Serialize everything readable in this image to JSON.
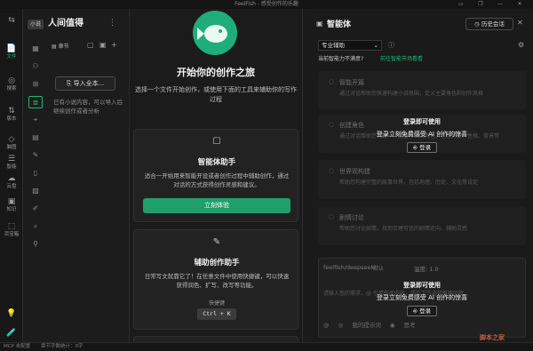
{
  "window": {
    "title": "FeelFish - 感受创作的乐趣",
    "controls": [
      "▭",
      "❐",
      "—",
      "✕"
    ]
  },
  "rail": {
    "items": [
      {
        "icon": "📄",
        "label": "文件",
        "active": true
      },
      {
        "icon": "◎",
        "label": "搜索"
      },
      {
        "icon": "⇅",
        "label": "版本"
      },
      {
        "icon": "◇",
        "label": "脑图"
      },
      {
        "icon": "☰",
        "label": "智能"
      },
      {
        "icon": "☁",
        "label": "云盘"
      },
      {
        "icon": "▣",
        "label": "知识"
      },
      {
        "icon": "⬚",
        "label": "百宝箱"
      }
    ],
    "bottom": [
      "💡",
      "🧪"
    ]
  },
  "files": {
    "type_badge": "小说",
    "book_title": "人间值得",
    "chapter_header": "章节",
    "import_button": "导入全本...",
    "import_hint": "已有小说内容，可以导入后继续创作或者分析"
  },
  "main": {
    "headline": "开始你的创作之旅",
    "subline": "选择一个文件开始创作，或使用下面的工具来辅助你的写作过程",
    "card1": {
      "icon": "☐",
      "title": "智能体助手",
      "desc": "适合一开始用来智能开设或者创作过程中辅助创作，通过对话的方式获得创作灵感和建议。",
      "button": "立刻体验"
    },
    "card2": {
      "icon": "✎",
      "title": "辅助创作助手",
      "desc": "日常写文就靠它了！在任意文件中使用快捷键，可以快速获得润色、扩写、改写等功能。",
      "shortcut_label": "快捷键",
      "shortcut": "Ctrl + K"
    }
  },
  "agent": {
    "title": "智能体",
    "history_button": "历史会话",
    "mode": "专业辅助",
    "mode_note": "当前智能力不满意?",
    "mode_link": "前往智能市场看看",
    "items": [
      {
        "title": "智能开篇",
        "desc": "通过对话帮助您快速构建小说氛围，定义主要角色和创作风格"
      },
      {
        "title": "创建角色",
        "desc": "通过对话帮助您构建一个完整丰满的角色，包括外貌、性格、背景等"
      },
      {
        "title": "世界观构建",
        "desc": "帮助您构建完整的故事世界，包括地理、历史、文化等设定"
      },
      {
        "title": "剧情讨论",
        "desc": "帮助您讨论剧情，找到合理可信的剧情走向，辅助灵感"
      }
    ],
    "login_title": "登录即可使用",
    "login_desc": "登录立刻免费感受 AI 创作的惊喜",
    "login_button": "登录",
    "model": "feelfish/deepseek",
    "model_tag": "默认",
    "temperature": "温度: 1.0",
    "placeholder": "请输入您的需求，@ 引用作品内容，或在下方选择推荐问题...",
    "tools": [
      "@",
      "◎",
      "我的提示词",
      "◉",
      "思考"
    ]
  },
  "status": {
    "left": "MCP 未配置",
    "mid": "章节字数统计：0字"
  },
  "watermark": "脚本之家"
}
